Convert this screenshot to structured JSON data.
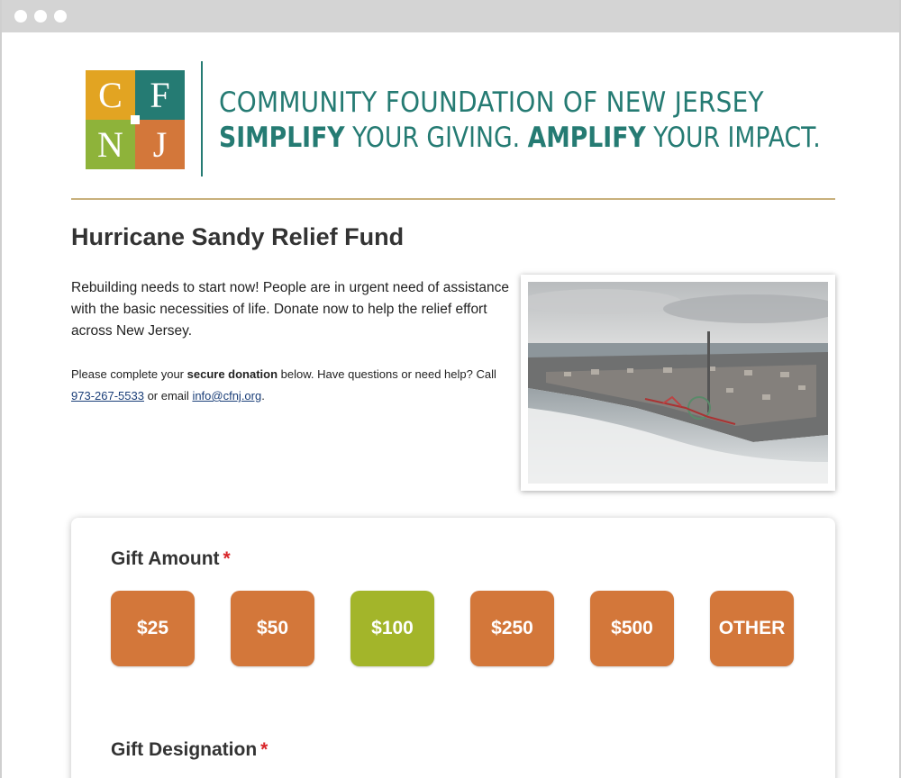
{
  "window": {
    "controls": [
      "close",
      "minimize",
      "zoom"
    ]
  },
  "logo": {
    "letters": [
      "C",
      "F",
      "N",
      "J"
    ],
    "colors": {
      "tl": "#e2a422",
      "tr": "#257b73",
      "bl": "#8eb33a",
      "br": "#d3773a"
    }
  },
  "header": {
    "org_name": "COMMUNITY FOUNDATION OF NEW JERSEY",
    "tagline_part1": "SIMPLIFY",
    "tagline_part2": " YOUR GIVING. ",
    "tagline_part3": "AMPLIFY",
    "tagline_part4": " YOUR IMPACT.",
    "brand_color": "#257b73"
  },
  "page": {
    "title": "Hurricane Sandy Relief Fund",
    "intro": "Rebuilding needs to start now! People are in urgent need of assistance with the basic necessities of life. Donate now to help the relief effort across New Jersey.",
    "help_prefix": "Please complete your ",
    "help_bold": "secure donation",
    "help_mid": " below. Have questions or need help? Call ",
    "help_phone": "973-267-5533",
    "help_or": " or email ",
    "help_email": "info@cfnj.org",
    "help_end": "."
  },
  "form": {
    "gift_amount_label": "Gift Amount",
    "required_marker": "*",
    "amounts": [
      {
        "label": "$25",
        "selected": false
      },
      {
        "label": "$50",
        "selected": false
      },
      {
        "label": "$100",
        "selected": true
      },
      {
        "label": "$250",
        "selected": false
      },
      {
        "label": "$500",
        "selected": false
      },
      {
        "label": "OTHER",
        "selected": false
      }
    ],
    "gift_designation_label": "Gift Designation",
    "accent_color": "#d3773a",
    "selected_color": "#a3b52a"
  }
}
